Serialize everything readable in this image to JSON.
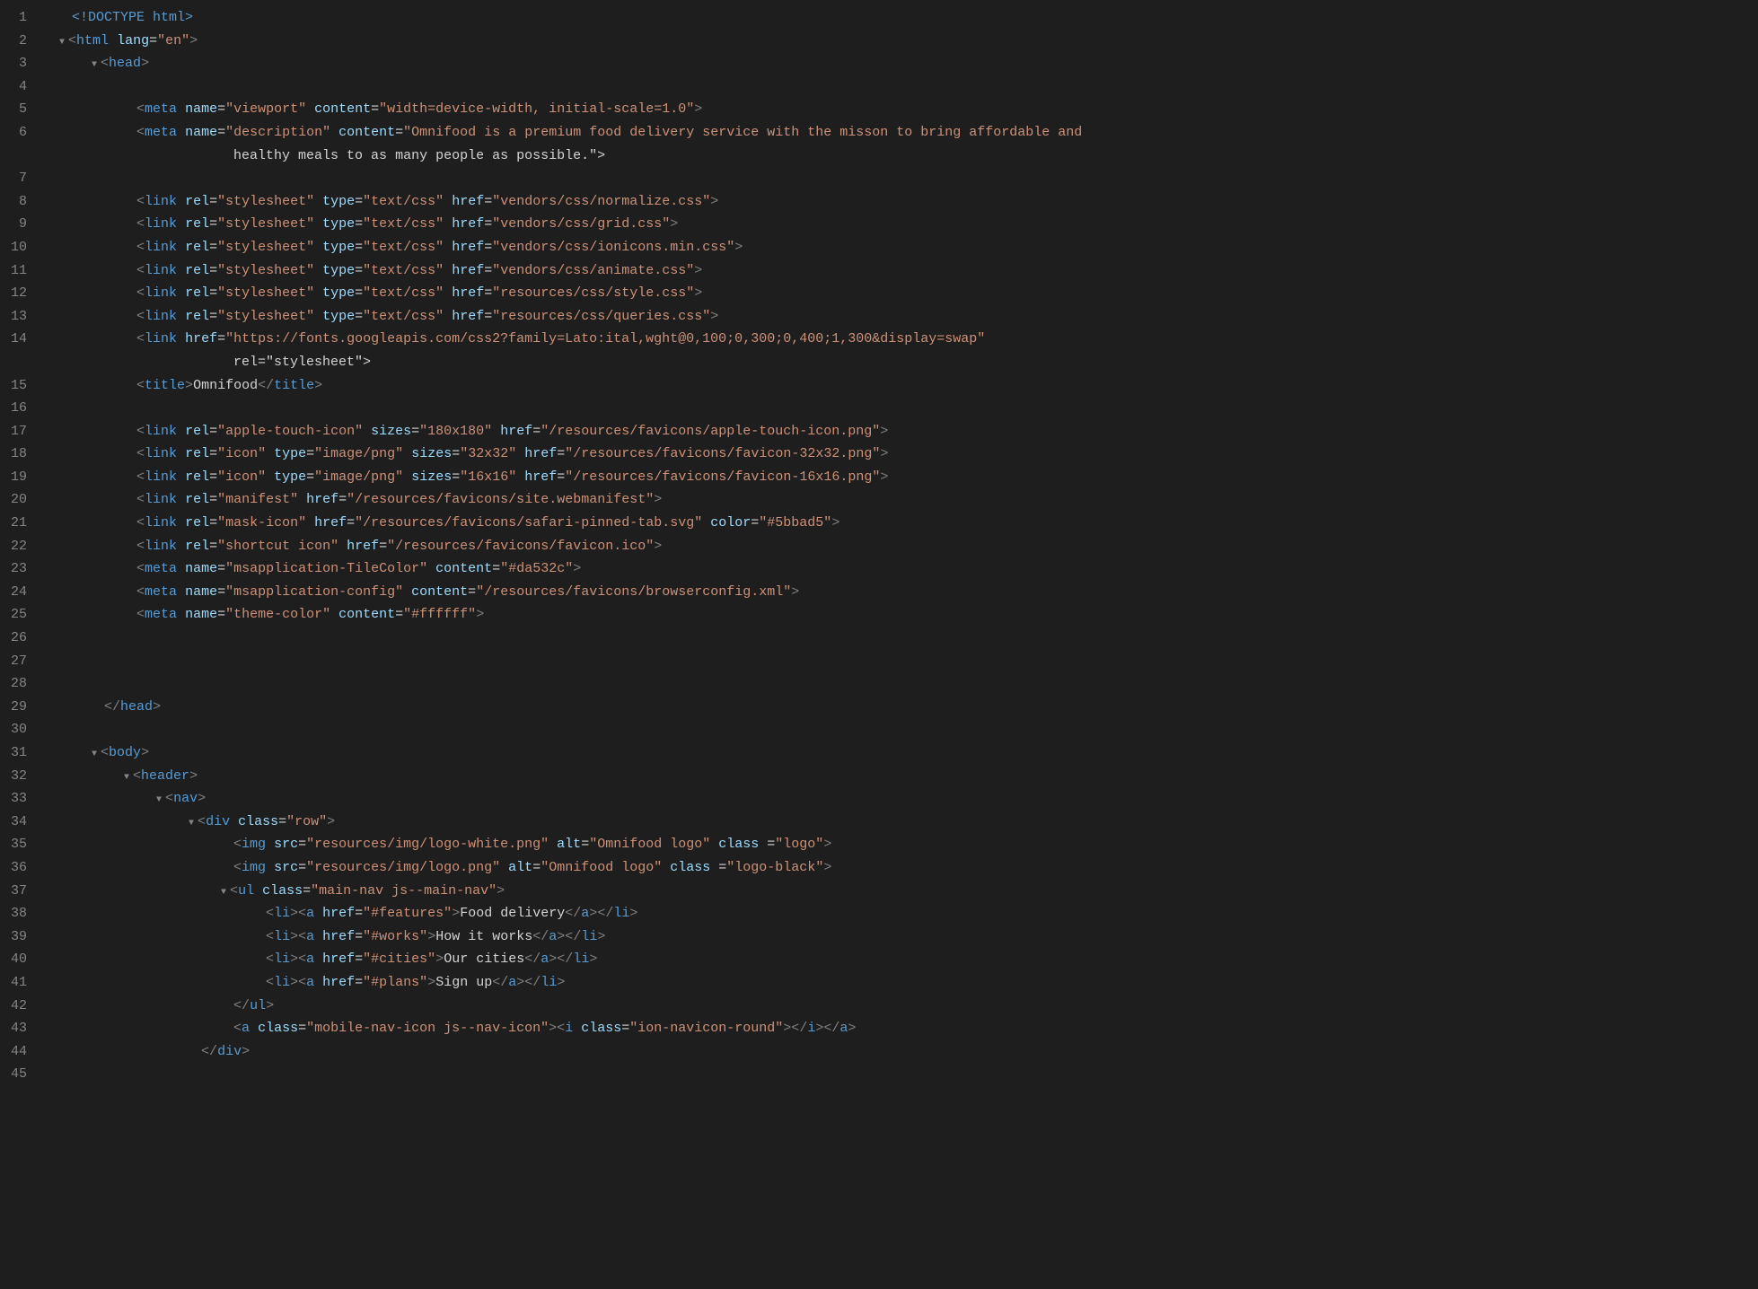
{
  "editor": {
    "background": "#1e1e1e",
    "lines": [
      {
        "num": 1,
        "indent": 0,
        "triangle": "",
        "content": "<!DOCTYPE html>",
        "type": "doctype"
      },
      {
        "num": 2,
        "indent": 0,
        "triangle": "down",
        "content": "<html lang=\"en\">",
        "type": "tag"
      },
      {
        "num": 3,
        "indent": 1,
        "triangle": "down",
        "content": "<head>",
        "type": "tag"
      },
      {
        "num": 4,
        "indent": 0,
        "triangle": "",
        "content": "",
        "type": "empty"
      },
      {
        "num": 5,
        "indent": 2,
        "triangle": "",
        "content": "<meta name=\"viewport\" content=\"width=device-width, initial-scale=1.0\">",
        "type": "tag"
      },
      {
        "num": 6,
        "indent": 2,
        "triangle": "",
        "content": "<meta name=\"description\" content=\"Omnifood is a premium food delivery service with the misson to bring affordable and",
        "type": "tag"
      },
      {
        "num": 6,
        "indent": 2,
        "triangle": "",
        "content": "            healthy meals to as many people as possible.\">",
        "type": "continuation"
      },
      {
        "num": 7,
        "indent": 0,
        "triangle": "",
        "content": "",
        "type": "empty"
      },
      {
        "num": 8,
        "indent": 2,
        "triangle": "",
        "content": "<link rel=\"stylesheet\" type=\"text/css\" href=\"vendors/css/normalize.css\">",
        "type": "tag"
      },
      {
        "num": 9,
        "indent": 2,
        "triangle": "",
        "content": "<link rel=\"stylesheet\" type=\"text/css\" href=\"vendors/css/grid.css\">",
        "type": "tag"
      },
      {
        "num": 10,
        "indent": 2,
        "triangle": "",
        "content": "<link rel=\"stylesheet\" type=\"text/css\" href=\"vendors/css/ionicons.min.css\">",
        "type": "tag"
      },
      {
        "num": 11,
        "indent": 2,
        "triangle": "",
        "content": "<link rel=\"stylesheet\" type=\"text/css\" href=\"vendors/css/animate.css\">",
        "type": "tag"
      },
      {
        "num": 12,
        "indent": 2,
        "triangle": "",
        "content": "<link rel=\"stylesheet\" type=\"text/css\" href=\"resources/css/style.css\">",
        "type": "tag"
      },
      {
        "num": 13,
        "indent": 2,
        "triangle": "",
        "content": "<link rel=\"stylesheet\" type=\"text/css\" href=\"resources/css/queries.css\">",
        "type": "tag"
      },
      {
        "num": 14,
        "indent": 2,
        "triangle": "",
        "content": "<link href=\"https://fonts.googleapis.com/css2?family=Lato:ital,wght@0,100;0,300;0,400;1,300&display=swap\"",
        "type": "tag"
      },
      {
        "num": 14,
        "indent": 2,
        "triangle": "",
        "content": "            rel=\"stylesheet\">",
        "type": "continuation"
      },
      {
        "num": 15,
        "indent": 2,
        "triangle": "",
        "content": "<title>Omnifood</title>",
        "type": "tag"
      },
      {
        "num": 16,
        "indent": 0,
        "triangle": "",
        "content": "",
        "type": "empty"
      },
      {
        "num": 17,
        "indent": 2,
        "triangle": "",
        "content": "<link rel=\"apple-touch-icon\" sizes=\"180x180\" href=\"/resources/favicons/apple-touch-icon.png\">",
        "type": "tag"
      },
      {
        "num": 18,
        "indent": 2,
        "triangle": "",
        "content": "<link rel=\"icon\" type=\"image/png\" sizes=\"32x32\" href=\"/resources/favicons/favicon-32x32.png\">",
        "type": "tag"
      },
      {
        "num": 19,
        "indent": 2,
        "triangle": "",
        "content": "<link rel=\"icon\" type=\"image/png\" sizes=\"16x16\" href=\"/resources/favicons/favicon-16x16.png\">",
        "type": "tag"
      },
      {
        "num": 20,
        "indent": 2,
        "triangle": "",
        "content": "<link rel=\"manifest\" href=\"/resources/favicons/site.webmanifest\">",
        "type": "tag"
      },
      {
        "num": 21,
        "indent": 2,
        "triangle": "",
        "content": "<link rel=\"mask-icon\" href=\"/resources/favicons/safari-pinned-tab.svg\" color=\"#5bbad5\">",
        "type": "tag"
      },
      {
        "num": 22,
        "indent": 2,
        "triangle": "",
        "content": "<link rel=\"shortcut icon\" href=\"/resources/favicons/favicon.ico\">",
        "type": "tag"
      },
      {
        "num": 23,
        "indent": 2,
        "triangle": "",
        "content": "<meta name=\"msapplication-TileColor\" content=\"#da532c\">",
        "type": "tag"
      },
      {
        "num": 24,
        "indent": 2,
        "triangle": "",
        "content": "<meta name=\"msapplication-config\" content=\"/resources/favicons/browserconfig.xml\">",
        "type": "tag"
      },
      {
        "num": 25,
        "indent": 2,
        "triangle": "",
        "content": "<meta name=\"theme-color\" content=\"#ffffff\">",
        "type": "tag"
      },
      {
        "num": 26,
        "indent": 0,
        "triangle": "",
        "content": "",
        "type": "empty"
      },
      {
        "num": 27,
        "indent": 0,
        "triangle": "",
        "content": "",
        "type": "empty"
      },
      {
        "num": 28,
        "indent": 0,
        "triangle": "",
        "content": "",
        "type": "empty"
      },
      {
        "num": 29,
        "indent": 1,
        "triangle": "",
        "content": "</head>",
        "type": "close-tag"
      },
      {
        "num": 30,
        "indent": 0,
        "triangle": "",
        "content": "",
        "type": "empty"
      },
      {
        "num": 31,
        "indent": 1,
        "triangle": "down",
        "content": "<body>",
        "type": "tag"
      },
      {
        "num": 32,
        "indent": 2,
        "triangle": "down",
        "content": "<header>",
        "type": "tag"
      },
      {
        "num": 33,
        "indent": 3,
        "triangle": "down",
        "content": "<nav>",
        "type": "tag"
      },
      {
        "num": 34,
        "indent": 4,
        "triangle": "down",
        "content": "<div class=\"row\">",
        "type": "tag"
      },
      {
        "num": 35,
        "indent": 5,
        "triangle": "",
        "content": "<img src=\"resources/img/logo-white.png\" alt=\"Omnifood logo\" class =\"logo\">",
        "type": "tag"
      },
      {
        "num": 36,
        "indent": 5,
        "triangle": "",
        "content": "<img src=\"resources/img/logo.png\" alt=\"Omnifood logo\" class =\"logo-black\">",
        "type": "tag"
      },
      {
        "num": 37,
        "indent": 5,
        "triangle": "down",
        "content": "<ul class=\"main-nav js--main-nav\">",
        "type": "tag"
      },
      {
        "num": 38,
        "indent": 6,
        "triangle": "",
        "content": "<li><a href=\"#features\">Food delivery</a></li>",
        "type": "tag"
      },
      {
        "num": 39,
        "indent": 6,
        "triangle": "",
        "content": "<li><a href=\"#works\">How it works</a></li>",
        "type": "tag"
      },
      {
        "num": 40,
        "indent": 6,
        "triangle": "",
        "content": "<li><a href=\"#cities\">Our cities</a></li>",
        "type": "tag"
      },
      {
        "num": 41,
        "indent": 6,
        "triangle": "",
        "content": "<li><a href=\"#plans\">Sign up</a></li>",
        "type": "tag"
      },
      {
        "num": 42,
        "indent": 5,
        "triangle": "",
        "content": "</ul>",
        "type": "close-tag"
      },
      {
        "num": 43,
        "indent": 5,
        "triangle": "",
        "content": "<a class=\"mobile-nav-icon js--nav-icon\"><i class=\"ion-navicon-round\"></i></a>",
        "type": "tag"
      },
      {
        "num": 44,
        "indent": 4,
        "triangle": "",
        "content": "</div>",
        "type": "close-tag"
      },
      {
        "num": 45,
        "indent": 0,
        "triangle": "",
        "content": "",
        "type": "empty"
      }
    ]
  }
}
